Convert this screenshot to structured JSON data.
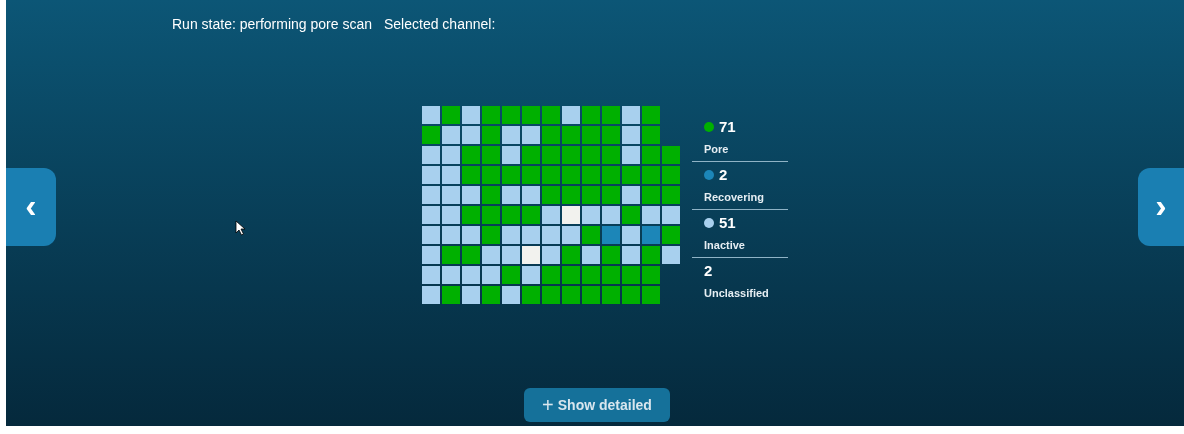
{
  "status": {
    "run_state": "Run state: performing pore scan",
    "selected_channel": "Selected channel:"
  },
  "nav": {
    "previous": "‹",
    "next": "›"
  },
  "grid": {
    "rows": [
      [
        {
          "kind": "inactive"
        },
        {
          "kind": "pore"
        },
        {
          "kind": "inactive"
        },
        {
          "kind": "pore"
        },
        {
          "kind": "pore"
        },
        {
          "kind": "pore"
        },
        {
          "kind": "pore"
        },
        {
          "kind": "inactive"
        },
        {
          "kind": "pore"
        },
        {
          "kind": "pore"
        },
        {
          "kind": "inactive"
        },
        {
          "kind": "pore"
        }
      ],
      [
        {
          "kind": "pore"
        },
        {
          "kind": "inactive"
        },
        {
          "kind": "inactive"
        },
        {
          "kind": "pore"
        },
        {
          "kind": "inactive"
        },
        {
          "kind": "inactive"
        },
        {
          "kind": "pore"
        },
        {
          "kind": "pore"
        },
        {
          "kind": "pore"
        },
        {
          "kind": "pore"
        },
        {
          "kind": "inactive"
        },
        {
          "kind": "pore"
        }
      ],
      [
        {
          "kind": "inactive"
        },
        {
          "kind": "inactive"
        },
        {
          "kind": "pore"
        },
        {
          "kind": "pore"
        },
        {
          "kind": "inactive"
        },
        {
          "kind": "pore"
        },
        {
          "kind": "pore"
        },
        {
          "kind": "pore"
        },
        {
          "kind": "pore"
        },
        {
          "kind": "pore"
        },
        {
          "kind": "inactive"
        },
        {
          "kind": "pore"
        },
        {
          "kind": "pore"
        }
      ],
      [
        {
          "kind": "inactive"
        },
        {
          "kind": "inactive"
        },
        {
          "kind": "pore"
        },
        {
          "kind": "pore"
        },
        {
          "kind": "pore"
        },
        {
          "kind": "pore"
        },
        {
          "kind": "pore"
        },
        {
          "kind": "pore"
        },
        {
          "kind": "pore"
        },
        {
          "kind": "pore"
        },
        {
          "kind": "pore"
        },
        {
          "kind": "pore"
        },
        {
          "kind": "pore"
        }
      ],
      [
        {
          "kind": "inactive"
        },
        {
          "kind": "inactive"
        },
        {
          "kind": "inactive"
        },
        {
          "kind": "pore"
        },
        {
          "kind": "inactive"
        },
        {
          "kind": "inactive"
        },
        {
          "kind": "pore"
        },
        {
          "kind": "pore"
        },
        {
          "kind": "pore"
        },
        {
          "kind": "pore"
        },
        {
          "kind": "inactive"
        },
        {
          "kind": "pore"
        },
        {
          "kind": "pore"
        }
      ],
      [
        {
          "kind": "inactive"
        },
        {
          "kind": "inactive"
        },
        {
          "kind": "pore"
        },
        {
          "kind": "pore"
        },
        {
          "kind": "pore"
        },
        {
          "kind": "pore"
        },
        {
          "kind": "inactive"
        },
        {
          "kind": "unclassified"
        },
        {
          "kind": "inactive"
        },
        {
          "kind": "inactive"
        },
        {
          "kind": "pore"
        },
        {
          "kind": "inactive"
        },
        {
          "kind": "inactive"
        }
      ],
      [
        {
          "kind": "inactive"
        },
        {
          "kind": "inactive"
        },
        {
          "kind": "inactive"
        },
        {
          "kind": "pore"
        },
        {
          "kind": "inactive"
        },
        {
          "kind": "inactive"
        },
        {
          "kind": "inactive"
        },
        {
          "kind": "inactive"
        },
        {
          "kind": "pore"
        },
        {
          "kind": "recovering"
        },
        {
          "kind": "inactive"
        },
        {
          "kind": "recovering"
        },
        {
          "kind": "pore"
        }
      ],
      [
        {
          "kind": "inactive"
        },
        {
          "kind": "pore"
        },
        {
          "kind": "pore"
        },
        {
          "kind": "inactive"
        },
        {
          "kind": "inactive"
        },
        {
          "kind": "unclassified"
        },
        {
          "kind": "inactive"
        },
        {
          "kind": "pore"
        },
        {
          "kind": "inactive"
        },
        {
          "kind": "pore"
        },
        {
          "kind": "inactive"
        },
        {
          "kind": "pore"
        },
        {
          "kind": "inactive"
        }
      ],
      [
        {
          "kind": "inactive"
        },
        {
          "kind": "inactive"
        },
        {
          "kind": "inactive"
        },
        {
          "kind": "inactive"
        },
        {
          "kind": "pore"
        },
        {
          "kind": "inactive"
        },
        {
          "kind": "pore"
        },
        {
          "kind": "pore"
        },
        {
          "kind": "pore"
        },
        {
          "kind": "pore"
        },
        {
          "kind": "pore"
        },
        {
          "kind": "pore"
        }
      ],
      [
        {
          "kind": "inactive"
        },
        {
          "kind": "pore"
        },
        {
          "kind": "inactive"
        },
        {
          "kind": "pore"
        },
        {
          "kind": "inactive"
        },
        {
          "kind": "pore"
        },
        {
          "kind": "pore"
        },
        {
          "kind": "pore"
        },
        {
          "kind": "pore"
        },
        {
          "kind": "pore"
        },
        {
          "kind": "pore"
        },
        {
          "kind": "pore"
        }
      ]
    ]
  },
  "legend": [
    {
      "kind": "pore",
      "count": "71",
      "label": "Pore",
      "color": "#00b000",
      "dot": true
    },
    {
      "kind": "recovering",
      "count": "2",
      "label": "Recovering",
      "color": "#1c86b8",
      "dot": true
    },
    {
      "kind": "inactive",
      "count": "51",
      "label": "Inactive",
      "color": "#a8d0ee",
      "dot": true
    },
    {
      "kind": "unclassified",
      "count": "2",
      "label": "Unclassified",
      "color": "#f2f2ee",
      "dot": false
    }
  ],
  "show_detailed_button": {
    "icon": "+",
    "label": "Show detailed"
  }
}
